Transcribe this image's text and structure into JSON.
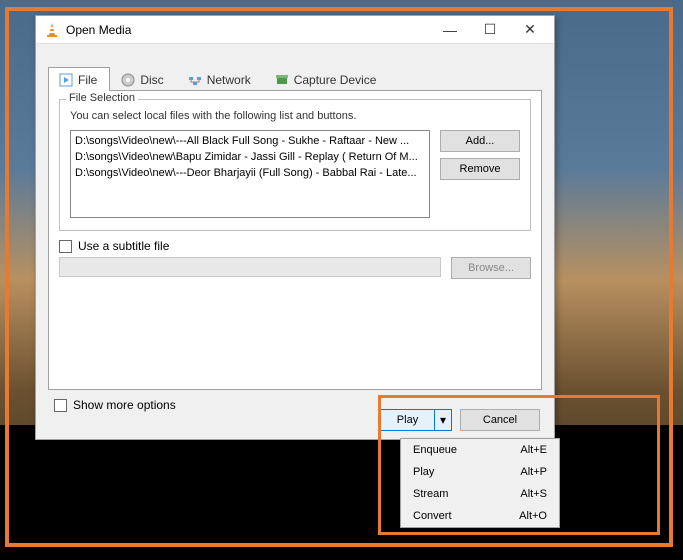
{
  "window": {
    "title": "Open Media"
  },
  "tabs": {
    "file": "File",
    "disc": "Disc",
    "network": "Network",
    "capture": "Capture Device"
  },
  "fileSelection": {
    "legend": "File Selection",
    "help": "You can select local files with the following list and buttons.",
    "items": [
      "D:\\songs\\Video\\new\\---All Black Full Song - Sukhe - Raftaar -  New ...",
      "D:\\songs\\Video\\new\\Bapu Zimidar - Jassi Gill - Replay ( Return Of M...",
      "D:\\songs\\Video\\new\\---Deor Bharjayii (Full Song) - Babbal Rai - Late..."
    ],
    "addLabel": "Add...",
    "removeLabel": "Remove"
  },
  "subtitle": {
    "label": "Use a subtitle file",
    "browse": "Browse..."
  },
  "options": {
    "showMore": "Show more options"
  },
  "actions": {
    "play": "Play",
    "cancel": "Cancel"
  },
  "menu": {
    "items": [
      {
        "label": "Enqueue",
        "shortcut": "Alt+E"
      },
      {
        "label": "Play",
        "shortcut": "Alt+P"
      },
      {
        "label": "Stream",
        "shortcut": "Alt+S"
      },
      {
        "label": "Convert",
        "shortcut": "Alt+O"
      }
    ]
  }
}
